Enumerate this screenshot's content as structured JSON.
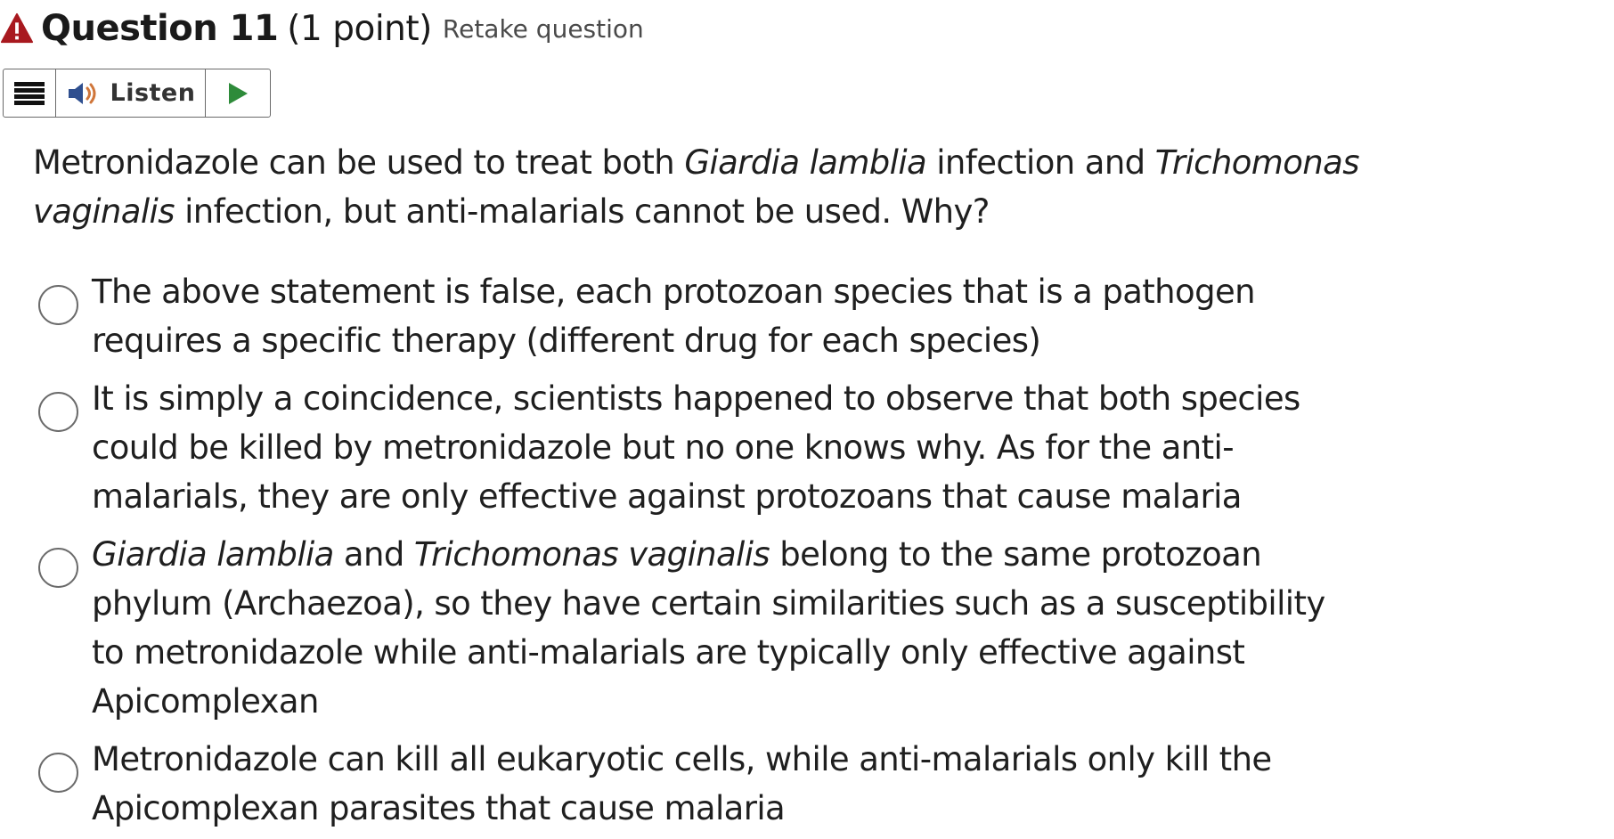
{
  "header": {
    "title": "Question 11",
    "points": "(1 point)",
    "retake_label": "Retake question",
    "warning_color": "#a8191f"
  },
  "toolbar": {
    "menu_icon": "hamburger-icon",
    "listen_label": "Listen",
    "speaker_icon": "speaker-icon",
    "play_icon": "play-icon",
    "play_color": "#2e8b3a"
  },
  "question": {
    "part1": "Metronidazole can be used to treat both ",
    "species1": "Giardia lamblia",
    "part2": " infection and ",
    "species2": "Trichomonas vaginalis",
    "part3": " infection, but anti-malarials cannot be used. Why?"
  },
  "options": [
    {
      "text": "The above statement is false, each protozoan species that is a pathogen requires a specific therapy (different drug for each species)"
    },
    {
      "text": "It is simply a coincidence, scientists happened to observe that both species could be killed by metronidazole but no one knows why. As for the anti-malarials, they are only effective against protozoans that cause malaria"
    },
    {
      "species1": "Giardia lamblia",
      "mid": " and ",
      "species2": "Trichomonas vaginalis",
      "rest": " belong to the same protozoan phylum (Archaezoa), so they have certain similarities such as a susceptibility to metronidazole while anti-malarials are typically only effective against Apicomplexan"
    },
    {
      "text": "Metronidazole can kill all eukaryotic cells, while anti-malarials only kill the Apicomplexan parasites that cause malaria"
    }
  ]
}
